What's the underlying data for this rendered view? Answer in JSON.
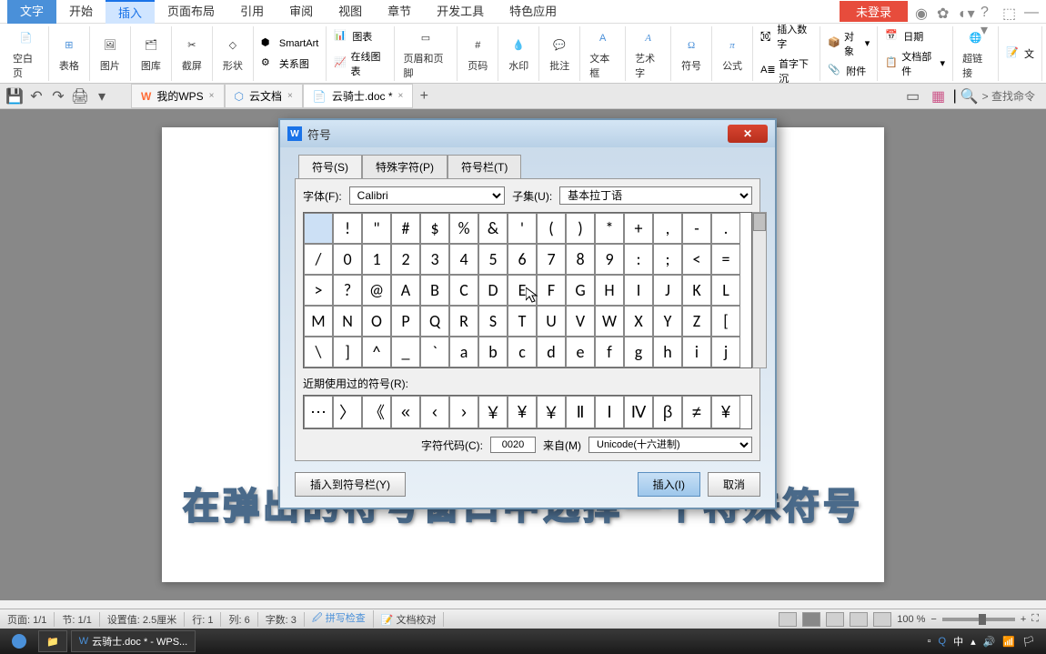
{
  "menu": {
    "items": [
      "文字",
      "开始",
      "插入",
      "页面布局",
      "引用",
      "审阅",
      "视图",
      "章节",
      "开发工具",
      "特色应用"
    ],
    "active": 2,
    "login": "未登录"
  },
  "ribbon": {
    "blank_page": "空白页",
    "table": "表格",
    "picture": "图片",
    "gallery": "图库",
    "screenshot": "截屏",
    "shapes": "形状",
    "smartart": "SmartArt",
    "chart": "图表",
    "relation": "关系图",
    "online_chart": "在线图表",
    "header_footer": "页眉和页脚",
    "page_num": "页码",
    "watermark": "水印",
    "comment": "批注",
    "textbox": "文本框",
    "wordart": "艺术字",
    "symbol": "符号",
    "equation": "公式",
    "insert_num": "插入数字",
    "first_char": "首字下沉",
    "object": "对象",
    "attachment": "附件",
    "date": "日期",
    "doc_parts": "文档部件",
    "hyperlink": "超链接",
    "text": "文"
  },
  "qa": {
    "search": "查找命令"
  },
  "tabs": [
    {
      "icon": "wps",
      "label": "我的WPS",
      "color": "#ff6b35"
    },
    {
      "icon": "cloud",
      "label": "云文档",
      "color": "#4a90d9"
    },
    {
      "icon": "doc",
      "label": "云骑士.doc *",
      "color": "#4a90d9",
      "active": true
    }
  ],
  "dialog": {
    "title": "符号",
    "tabs": [
      "符号(S)",
      "特殊字符(P)",
      "符号栏(T)"
    ],
    "font_label": "字体(F):",
    "font_value": "Calibri",
    "subset_label": "子集(U):",
    "subset_value": "基本拉丁语",
    "symbols": [
      [
        " ",
        "!",
        "\"",
        "#",
        "$",
        "%",
        "&",
        "'",
        "(",
        ")",
        "*",
        "+",
        ",",
        "-",
        "."
      ],
      [
        "/",
        "0",
        "1",
        "2",
        "3",
        "4",
        "5",
        "6",
        "7",
        "8",
        "9",
        ":",
        ";",
        "<",
        "="
      ],
      [
        ">",
        "?",
        "@",
        "A",
        "B",
        "C",
        "D",
        "E",
        "F",
        "G",
        "H",
        "I",
        "J",
        "K",
        "L"
      ],
      [
        "M",
        "N",
        "O",
        "P",
        "Q",
        "R",
        "S",
        "T",
        "U",
        "V",
        "W",
        "X",
        "Y",
        "Z",
        "["
      ],
      [
        "\\",
        "]",
        "^",
        "_",
        "`",
        "a",
        "b",
        "c",
        "d",
        "e",
        "f",
        "g",
        "h",
        "i",
        "j"
      ]
    ],
    "recent_label": "近期使用过的符号(R):",
    "recent": [
      "⋯",
      "〉",
      "《",
      "«",
      "‹",
      "›",
      "￥",
      "¥",
      "￥",
      "Ⅱ",
      "Ⅰ",
      "Ⅳ",
      "β",
      "≠",
      "¥"
    ],
    "code_label": "字符代码(C):",
    "code_value": "0020",
    "from_label": "来自(M)",
    "from_value": "Unicode(十六进制)",
    "insert_toolbar": "插入到符号栏(Y)",
    "insert": "插入(I)",
    "cancel": "取消"
  },
  "subtitle": "在弹出的符号窗口中选择一个特殊符号",
  "status": {
    "page": "页面: 1/1",
    "section": "节: 1/1",
    "setting": "设置值: 2.5厘米",
    "row": "行: 1",
    "col": "列: 6",
    "chars": "字数: 3",
    "spell": "拼写检查",
    "proofing": "文档校对",
    "zoom": "100 %"
  },
  "taskbar": {
    "app": "云骑士.doc * - WPS...",
    "ime": "中"
  }
}
